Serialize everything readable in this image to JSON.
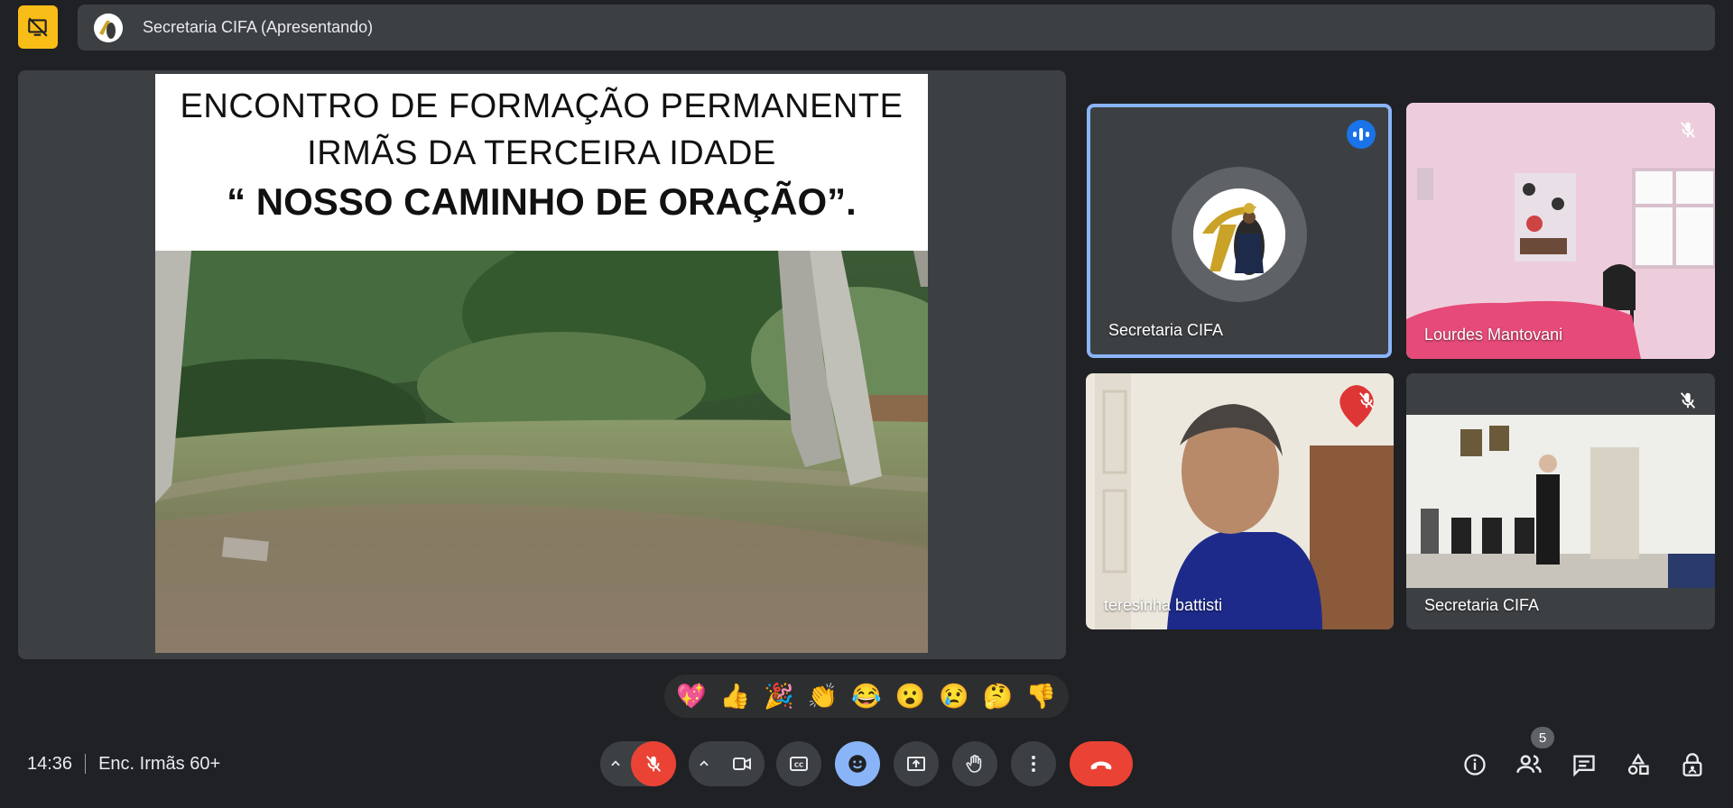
{
  "presenter_bar": {
    "title": "Secretaria CIFA (Apresentando)"
  },
  "slide": {
    "line1": "ENCONTRO DE FORMAÇÃO PERMANENTE",
    "line2": "IRMÃS DA TERCEIRA IDADE",
    "line3": "“ NOSSO CAMINHO DE ORAÇÃO”."
  },
  "participants": [
    {
      "name": "Secretaria CIFA",
      "state": "speaking"
    },
    {
      "name": "Lourdes Mantovani",
      "state": "muted"
    },
    {
      "name": "teresinha battisti",
      "state": "muted"
    },
    {
      "name": "Secretaria CIFA",
      "state": "muted"
    }
  ],
  "reactions": [
    "💖",
    "👍",
    "🎉",
    "👏",
    "😂",
    "😮",
    "😢",
    "🤔",
    "👎"
  ],
  "meeting": {
    "time": "14:36",
    "name": "Enc. Irmãs 60+"
  },
  "people_count": "5",
  "colors": {
    "background": "#202124",
    "tile": "#3c4043",
    "accent_blue": "#8ab4f8",
    "hangup_red": "#ea4335",
    "presenting_yellow": "#f9bd17"
  },
  "icons": [
    "stop-presenting-icon",
    "mic-off-icon",
    "camera-icon",
    "captions-icon",
    "emoji-icon",
    "present-screen-icon",
    "raise-hand-icon",
    "more-options-icon",
    "hangup-icon",
    "info-icon",
    "people-icon",
    "chat-icon",
    "activities-icon",
    "host-controls-icon"
  ]
}
